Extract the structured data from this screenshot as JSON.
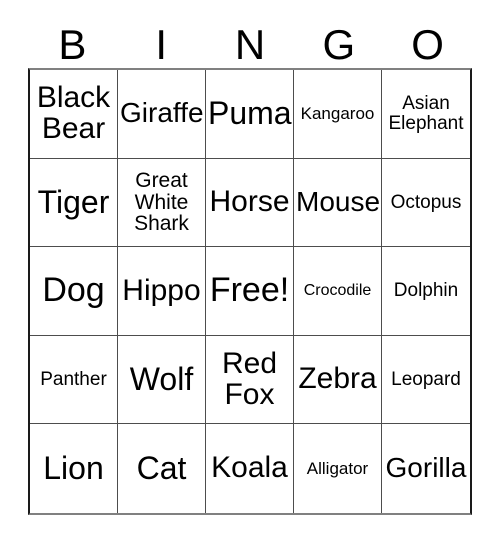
{
  "card": {
    "title_letters": [
      "B",
      "I",
      "N",
      "G",
      "O"
    ],
    "free_space": "Free!",
    "colors": {
      "text": "#000000",
      "background": "#ffffff",
      "grid_line": "#4d4d4d",
      "outer_border": "#1a1a1a"
    },
    "grid": {
      "columns": 5,
      "rows": 5
    },
    "cells": [
      {
        "label": "Black\nBear",
        "size": "fs-md"
      },
      {
        "label": "Giraffe",
        "size": "fs-sm"
      },
      {
        "label": "Puma",
        "size": "fs-lg"
      },
      {
        "label": "Kangaroo",
        "size": "fs-tiny"
      },
      {
        "label": "Asian\nElephant",
        "size": "fs-xxs"
      },
      {
        "label": "Tiger",
        "size": "fs-lg"
      },
      {
        "label": "Great\nWhite\nShark",
        "size": "fs-xs"
      },
      {
        "label": "Horse",
        "size": "fs-md"
      },
      {
        "label": "Mouse",
        "size": "fs-sm"
      },
      {
        "label": "Octopus",
        "size": "fs-xxs"
      },
      {
        "label": "Dog",
        "size": "fs-xl"
      },
      {
        "label": "Hippo",
        "size": "fs-md"
      },
      {
        "label": "Free!",
        "size": "fs-xl"
      },
      {
        "label": "Crocodile",
        "size": "fs-mini"
      },
      {
        "label": "Dolphin",
        "size": "fs-xxs"
      },
      {
        "label": "Panther",
        "size": "fs-xxs"
      },
      {
        "label": "Wolf",
        "size": "fs-lg"
      },
      {
        "label": "Red\nFox",
        "size": "fs-md"
      },
      {
        "label": "Zebra",
        "size": "fs-md"
      },
      {
        "label": "Leopard",
        "size": "fs-xxs"
      },
      {
        "label": "Lion",
        "size": "fs-lg"
      },
      {
        "label": "Cat",
        "size": "fs-lg"
      },
      {
        "label": "Koala",
        "size": "fs-md"
      },
      {
        "label": "Alligator",
        "size": "fs-tiny"
      },
      {
        "label": "Gorilla",
        "size": "fs-sm"
      }
    ]
  }
}
